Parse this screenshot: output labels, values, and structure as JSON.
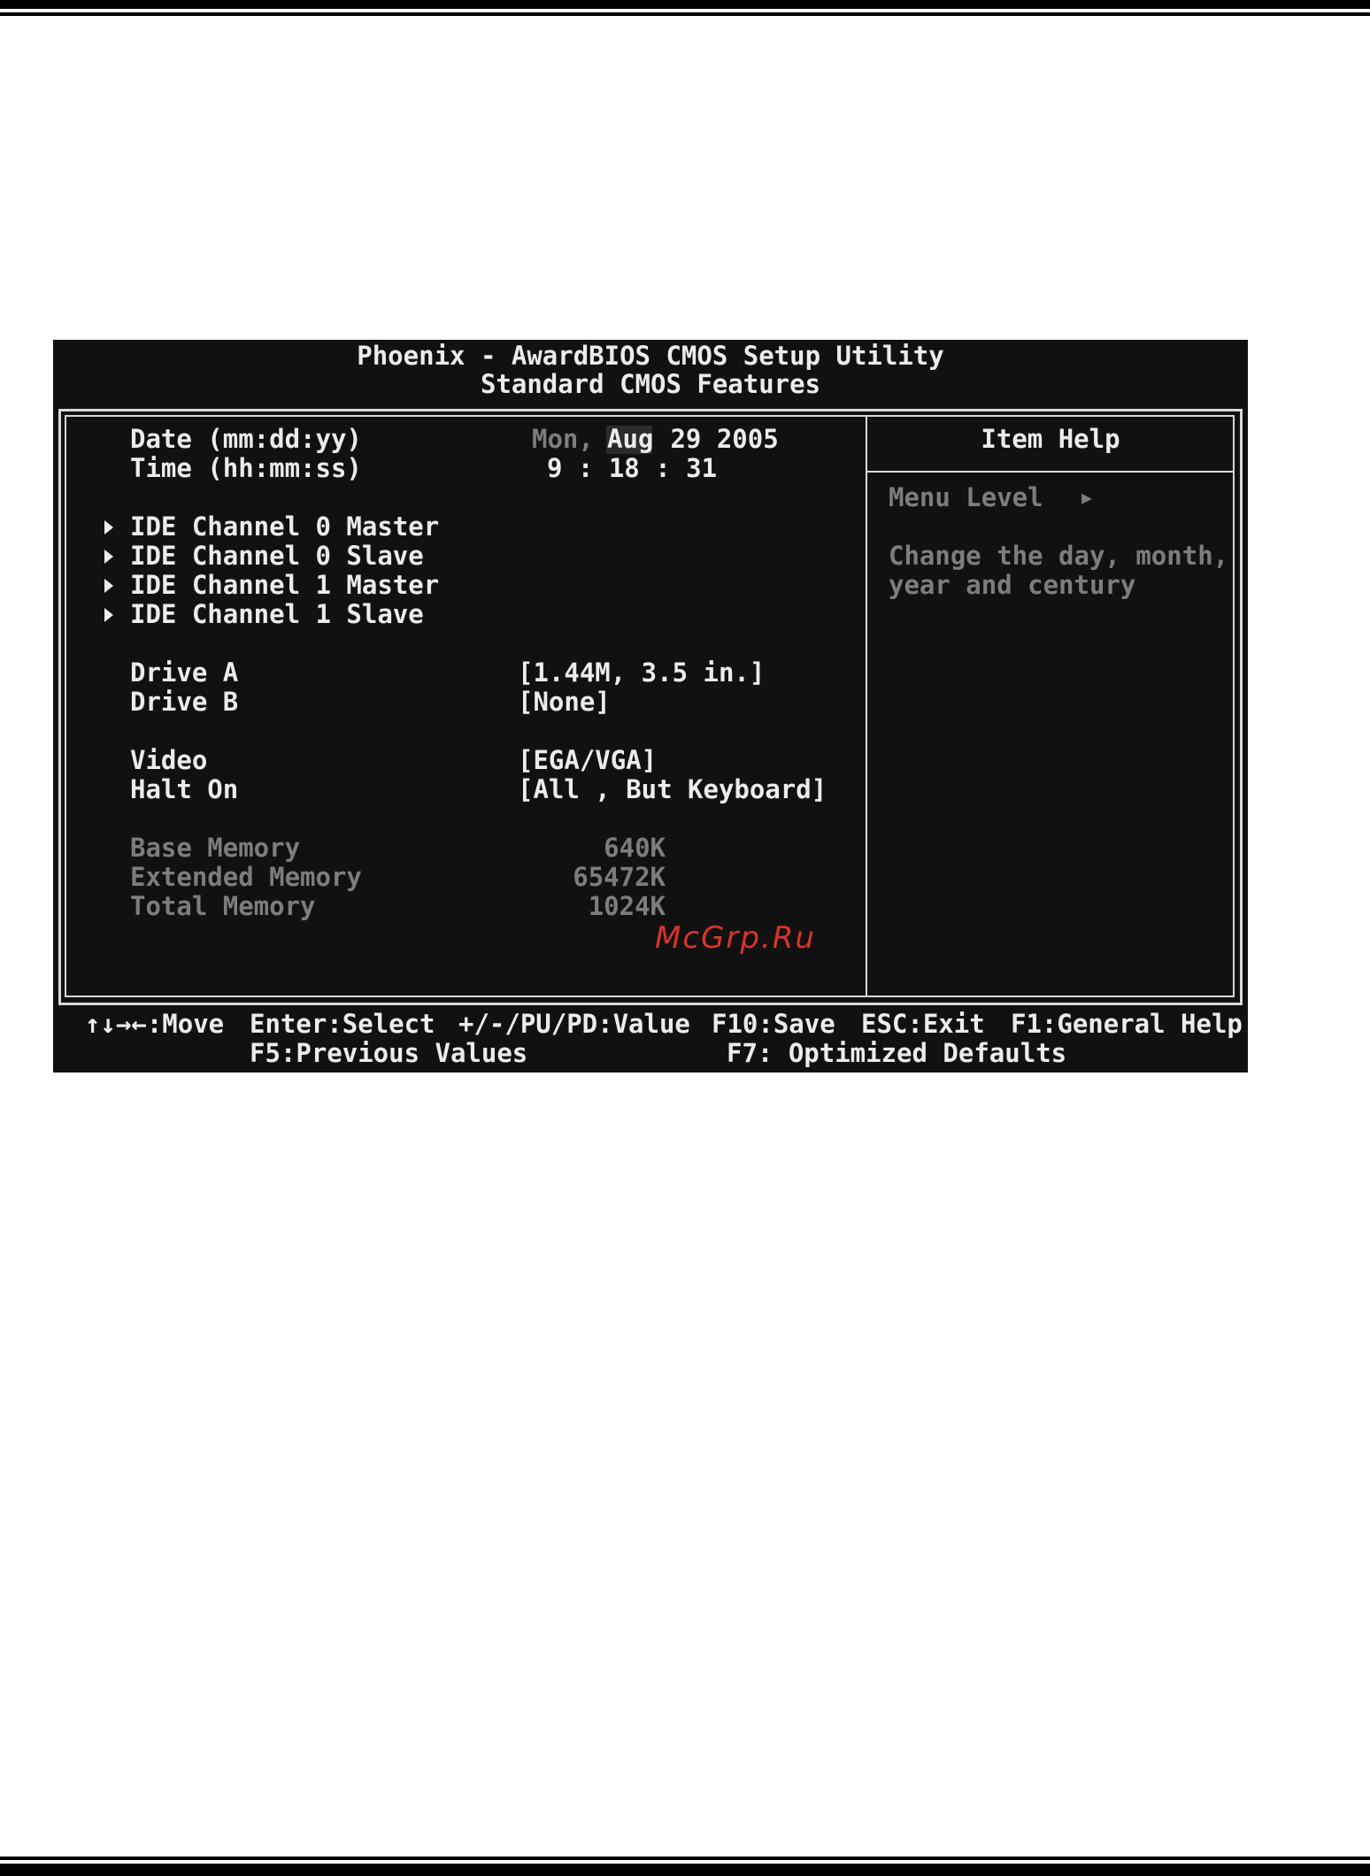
{
  "header": {
    "title": "Phoenix - AwardBIOS CMOS Setup Utility",
    "subtitle": "Standard CMOS Features"
  },
  "items": {
    "date": {
      "label": "Date (mm:dd:yy)",
      "weekday": "Mon,",
      "month": "Aug",
      "rest": " 29 2005"
    },
    "time": {
      "label": "Time (hh:mm:ss)",
      "value": "9 : 18 : 31"
    },
    "ide0_master": "IDE Channel 0 Master",
    "ide0_slave": "IDE Channel 0 Slave",
    "ide1_master": "IDE Channel 1 Master",
    "ide1_slave": "IDE Channel 1 Slave",
    "drive_a": {
      "label": "Drive A",
      "value": "[1.44M, 3.5 in.]"
    },
    "drive_b": {
      "label": "Drive B",
      "value": "[None]"
    },
    "video": {
      "label": "Video",
      "value": "[EGA/VGA]"
    },
    "halt_on": {
      "label": "Halt On",
      "value": "[All , But Keyboard]"
    },
    "base_memory": {
      "label": "Base Memory",
      "value": "640K"
    },
    "extended_memory": {
      "label": "Extended Memory",
      "value": "65472K"
    },
    "total_memory": {
      "label": "Total Memory",
      "value": "1024K"
    }
  },
  "help": {
    "title": "Item Help",
    "menu_level": "Menu Level",
    "menu_level_arrow": "▶",
    "line1": "Change the day, month,",
    "line2": "year and century"
  },
  "footer": {
    "move": "↑↓→←:Move",
    "select": "Enter:Select",
    "value": "+/-/PU/PD:Value",
    "save": "F10:Save",
    "exit": "ESC:Exit",
    "general_help": "F1:General Help",
    "previous_values": "F5:Previous Values",
    "optimized_defaults": "F7: Optimized Defaults"
  },
  "watermark": "McGrp.Ru",
  "colors": {
    "screen_bg": "#111111",
    "text": "#ececec",
    "dim_text": "#7d7d7d",
    "watermark": "#d9342b"
  }
}
